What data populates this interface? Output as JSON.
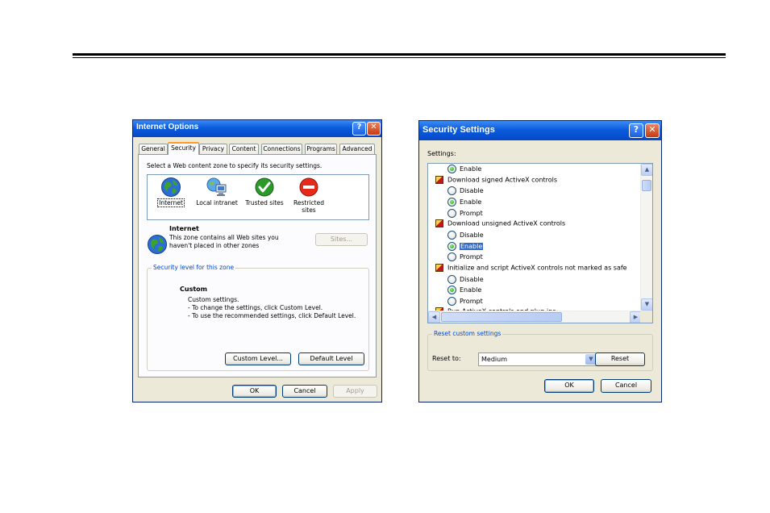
{
  "internet_options": {
    "title": "Internet Options",
    "tabs": [
      "General",
      "Security",
      "Privacy",
      "Content",
      "Connections",
      "Programs",
      "Advanced"
    ],
    "active_tab": "Security",
    "zone_prompt": "Select a Web content zone to specify its security settings.",
    "zones": [
      {
        "label": "Internet",
        "icon": "globe-icon"
      },
      {
        "label": "Local intranet",
        "icon": "computer-network-icon"
      },
      {
        "label": "Trusted sites",
        "icon": "check-circle-icon"
      },
      {
        "label": "Restricted sites",
        "icon": "no-entry-icon"
      }
    ],
    "selected_zone": {
      "name": "Internet",
      "description": "This zone contains all Web sites you haven't placed in other zones"
    },
    "sites_button": "Sites...",
    "security_level_group": "Security level for this zone",
    "level_name": "Custom",
    "level_description": [
      "Custom settings.",
      "- To change the settings, click Custom Level.",
      "- To use the recommended settings, click Default Level."
    ],
    "custom_level_button": "Custom Level...",
    "default_level_button": "Default Level",
    "ok_button": "OK",
    "cancel_button": "Cancel",
    "apply_button": "Apply"
  },
  "security_settings": {
    "title": "Security Settings",
    "settings_label": "Settings:",
    "items": [
      {
        "kind": "option",
        "label": "Enable",
        "checked": true
      },
      {
        "kind": "header",
        "label": "Download signed ActiveX controls"
      },
      {
        "kind": "option",
        "label": "Disable",
        "checked": false
      },
      {
        "kind": "option",
        "label": "Enable",
        "checked": true
      },
      {
        "kind": "option",
        "label": "Prompt",
        "checked": false
      },
      {
        "kind": "header",
        "label": "Download unsigned ActiveX controls"
      },
      {
        "kind": "option",
        "label": "Disable",
        "checked": false
      },
      {
        "kind": "option",
        "label": "Enable",
        "checked": true,
        "highlighted": true
      },
      {
        "kind": "option",
        "label": "Prompt",
        "checked": false
      },
      {
        "kind": "header",
        "label": "Initialize and script ActiveX controls not marked as safe"
      },
      {
        "kind": "option",
        "label": "Disable",
        "checked": false
      },
      {
        "kind": "option",
        "label": "Enable",
        "checked": true
      },
      {
        "kind": "option",
        "label": "Prompt",
        "checked": false
      },
      {
        "kind": "header",
        "label": "Run ActiveX controls and plug-ins"
      }
    ],
    "reset_group": "Reset custom settings",
    "reset_to_label": "Reset to:",
    "reset_select_value": "Medium",
    "reset_button": "Reset",
    "ok_button": "OK",
    "cancel_button": "Cancel"
  },
  "colors": {
    "titlebar": "#0a5cdc",
    "dialog_bg": "#ece9d8",
    "selection": "#316ac5",
    "group_label": "#0046d5"
  }
}
